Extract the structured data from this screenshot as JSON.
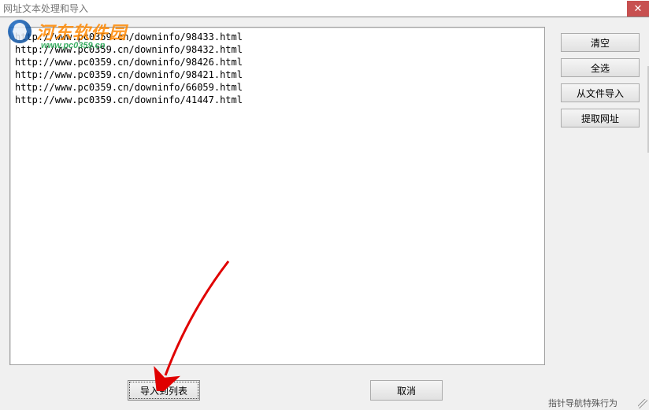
{
  "window": {
    "title": "网址文本处理和导入",
    "close_symbol": "✕"
  },
  "textarea": {
    "lines": [
      "http://www.pc0359.cn/downinfo/98433.html",
      "http://www.pc0359.cn/downinfo/98432.html",
      "http://www.pc0359.cn/downinfo/98426.html",
      "http://www.pc0359.cn/downinfo/98421.html",
      "http://www.pc0359.cn/downinfo/66059.html",
      "http://www.pc0359.cn/downinfo/41447.html"
    ]
  },
  "side": {
    "clear": "清空",
    "select_all": "全选",
    "import_from_file": "从文件导入",
    "extract_urls": "提取网址"
  },
  "bottom": {
    "import_to_list": "导入到列表",
    "cancel": "取消"
  },
  "watermark": {
    "cn": "河东软件园",
    "en": "www.pc0359.cn"
  },
  "status": "指针导航特殊行为"
}
